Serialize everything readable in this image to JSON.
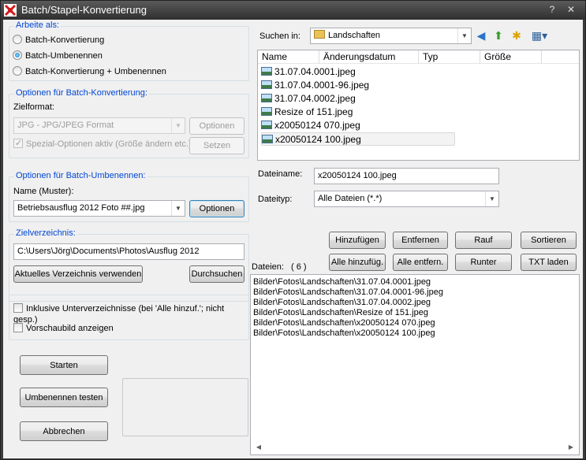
{
  "window": {
    "title": "Batch/Stapel-Konvertierung"
  },
  "arbeite": {
    "legend": "Arbeite als:",
    "options": [
      {
        "label": "Batch-Konvertierung",
        "selected": false
      },
      {
        "label": "Batch-Umbenennen",
        "selected": true
      },
      {
        "label": "Batch-Konvertierung + Umbenennen",
        "selected": false
      }
    ]
  },
  "konvertierung": {
    "legend": "Optionen für Batch-Konvertierung:",
    "zielformat_label": "Zielformat:",
    "zielformat_value": "JPG - JPG/JPEG Format",
    "optionen_button": "Optionen",
    "spezial_label": "Spezial-Optionen aktiv (Größe ändern etc.)",
    "spezial_checked": true,
    "setzen_button": "Setzen"
  },
  "umbenennen": {
    "legend": "Optionen für Batch-Umbenennen:",
    "name_label": "Name (Muster):",
    "name_value": "Betriebsausflug 2012 Foto ##.jpg",
    "optionen_button": "Optionen"
  },
  "ziel": {
    "legend": "Zielverzeichnis:",
    "path": "C:\\Users\\Jörg\\Documents\\Photos\\Ausflug 2012",
    "current_button": "Aktuelles Verzeichnis verwenden",
    "browse_button": "Durchsuchen"
  },
  "extra": {
    "subdirs_label": "Inklusive Unterverzeichnisse (bei 'Alle hinzuf.'; nicht gesp.)",
    "preview_label": "Vorschaubild anzeigen"
  },
  "actions": {
    "start": "Starten",
    "test": "Umbenennen testen",
    "cancel": "Abbrechen"
  },
  "browser": {
    "suchen_label": "Suchen in:",
    "folder": "Landschaften",
    "columns": [
      "Name",
      "Änderungsdatum",
      "Typ",
      "Größe"
    ],
    "files": [
      "31.07.04.0001.jpeg",
      "31.07.04.0001-96.jpeg",
      "31.07.04.0002.jpeg",
      "Resize of  151.jpeg",
      "x20050124 070.jpeg",
      "x20050124 100.jpeg"
    ],
    "dateiname_label": "Dateiname:",
    "dateiname_value": "x20050124 100.jpeg",
    "dateityp_label": "Dateityp:",
    "dateityp_value": "Alle Dateien (*.*)"
  },
  "list_buttons": {
    "add": "Hinzufügen",
    "remove": "Entfernen",
    "up": "Rauf",
    "sort": "Sortieren",
    "add_all": "Alle hinzufüg.",
    "remove_all": "Alle entfern.",
    "down": "Runter",
    "load_txt": "TXT laden"
  },
  "dateien": {
    "label": "Dateien:",
    "count": "( 6 )",
    "items": [
      "Bilder\\Fotos\\Landschaften\\31.07.04.0001.jpeg",
      "Bilder\\Fotos\\Landschaften\\31.07.04.0001-96.jpeg",
      "Bilder\\Fotos\\Landschaften\\31.07.04.0002.jpeg",
      "Bilder\\Fotos\\Landschaften\\Resize of  151.jpeg",
      "Bilder\\Fotos\\Landschaften\\x20050124 070.jpeg",
      "Bilder\\Fotos\\Landschaften\\x20050124 100.jpeg"
    ]
  }
}
